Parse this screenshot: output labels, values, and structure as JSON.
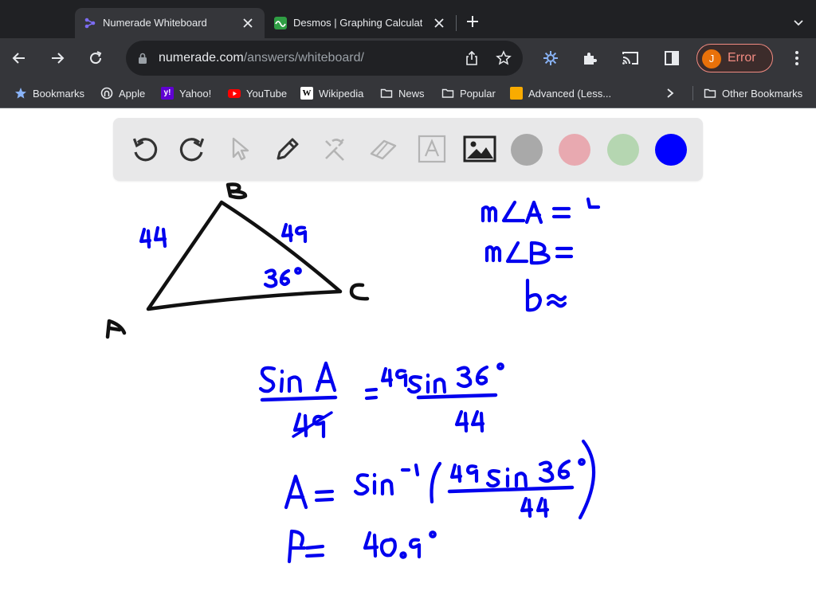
{
  "browser": {
    "tabs": [
      {
        "title": "Numerade Whiteboard",
        "active": true,
        "favicon": "numerade-logo-icon"
      },
      {
        "title": "Desmos | Graphing Calculator",
        "active": false,
        "favicon": "desmos-logo-icon"
      }
    ],
    "url_host": "numerade.com",
    "url_path": "/answers/whiteboard/",
    "profile": {
      "initial": "J",
      "status": "Error",
      "status_color": "#f28b82"
    },
    "bookmarks": [
      {
        "label": "Bookmarks",
        "icon": "star-icon"
      },
      {
        "label": "Apple",
        "icon": "apple-icon"
      },
      {
        "label": "Yahoo!",
        "icon": "yahoo-icon"
      },
      {
        "label": "YouTube",
        "icon": "youtube-icon"
      },
      {
        "label": "Wikipedia",
        "icon": "wikipedia-icon"
      },
      {
        "label": "News",
        "icon": "folder-icon"
      },
      {
        "label": "Popular",
        "icon": "folder-icon"
      },
      {
        "label": "Advanced (Less...",
        "icon": "advanced-icon"
      }
    ],
    "other_bookmarks": "Other Bookmarks"
  },
  "whiteboard": {
    "tools": [
      "undo-icon",
      "redo-icon",
      "pointer-icon",
      "pen-icon",
      "tools-icon",
      "eraser-icon",
      "text-icon",
      "image-icon"
    ],
    "colors": [
      "#a9a9a9",
      "#e8a9b0",
      "#b5d6b1",
      "#0000ff"
    ],
    "selected_color": "#0000ff",
    "ink_color": "#0000ee"
  }
}
